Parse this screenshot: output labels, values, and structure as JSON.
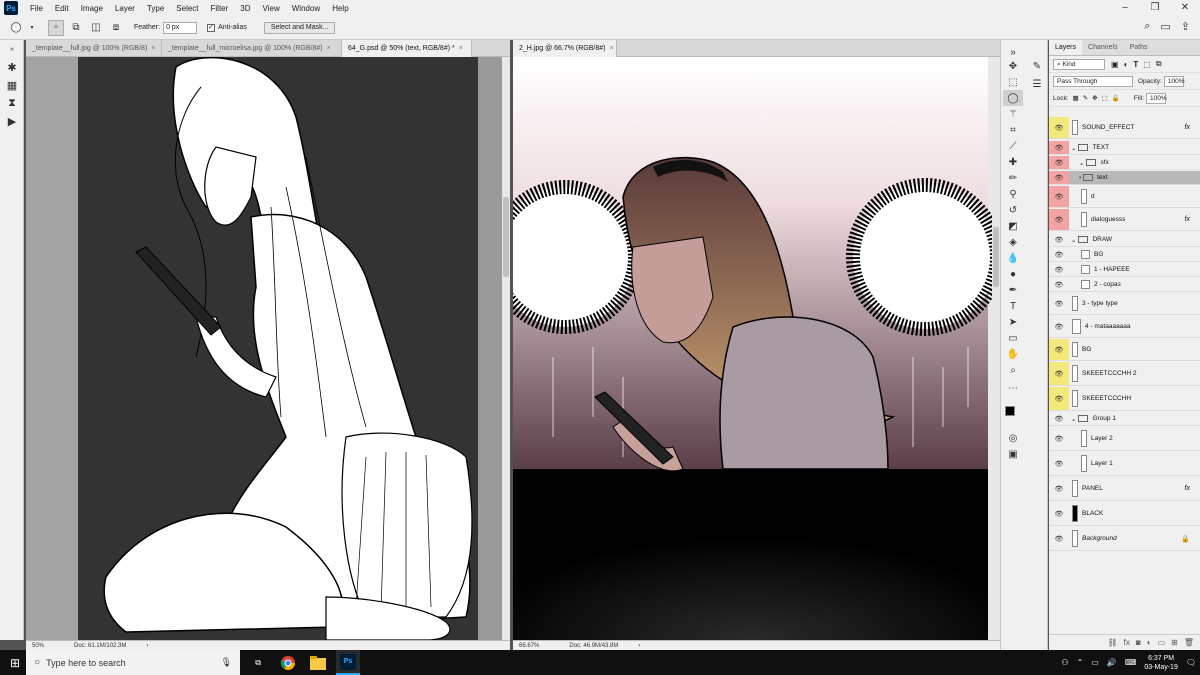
{
  "menubar": {
    "logo": "Ps",
    "items": [
      "File",
      "Edit",
      "Image",
      "Layer",
      "Type",
      "Select",
      "Filter",
      "3D",
      "View",
      "Window",
      "Help"
    ]
  },
  "options": {
    "feather_label": "Feather:",
    "feather_value": "0 px",
    "antialias_label": "Anti-alias",
    "select_mask_label": "Select and Mask..."
  },
  "documents": {
    "tabs_left": [
      "_template__full.jpg @ 100% (RGB/8)",
      "_template__full_microelisa.jpg @ 100% (RGB/8#)",
      "64_G.psd @ 50% (text, RGB/8#) *"
    ],
    "tabs_right": [
      "2_H.jpg @ 66.7% (RGB/8#)"
    ],
    "left_zoom": "50%",
    "left_doc": "Doc: 61.1M/102.3M",
    "right_zoom": "66.67%",
    "right_doc": "Doc: 46.9M/43.8M"
  },
  "panel": {
    "tabs": [
      "Layers",
      "Channels",
      "Paths"
    ],
    "kind": "Kind",
    "blend_mode": "Pass Through",
    "opacity_label": "Opacity:",
    "opacity_value": "100%",
    "lock_label": "Lock:",
    "fill_label": "Fill:",
    "fill_value": "100%",
    "layers": [
      {
        "name": "SOUND_EFFECT",
        "color": "#f3e97a",
        "fx": "fx"
      },
      {
        "name": "TEXT",
        "color": "#f4a3a3",
        "fx": ""
      },
      {
        "name": "sfx",
        "color": "#f4a3a3",
        "fx": ""
      },
      {
        "name": "text",
        "color": "#f4a3a3",
        "fx": ""
      },
      {
        "name": "d",
        "color": "#f4a3a3",
        "fx": ""
      },
      {
        "name": "dialoguesss",
        "color": "#f4a3a3",
        "fx": "fx"
      },
      {
        "name": "DRAW",
        "color": "",
        "fx": ""
      },
      {
        "name": "BG",
        "color": "",
        "fx": ""
      },
      {
        "name": "1 - HAPEEE",
        "color": "",
        "fx": ""
      },
      {
        "name": "2 - copas",
        "color": "",
        "fx": ""
      },
      {
        "name": "3 - type type",
        "color": "",
        "fx": ""
      },
      {
        "name": "4 - mataaaaaaa",
        "color": "",
        "fx": ""
      },
      {
        "name": "BG",
        "color": "#f3e97a",
        "fx": ""
      },
      {
        "name": "SKEEETCCCHH 2",
        "color": "#f3e97a",
        "fx": ""
      },
      {
        "name": "SKEEETCCCHH",
        "color": "#f3e97a",
        "fx": ""
      },
      {
        "name": "Group 1",
        "color": "",
        "fx": ""
      },
      {
        "name": "Layer 2",
        "color": "",
        "fx": ""
      },
      {
        "name": "Layer 1",
        "color": "",
        "fx": ""
      },
      {
        "name": "PANEL",
        "color": "",
        "fx": "fx"
      },
      {
        "name": "BLACK",
        "color": "",
        "fx": ""
      },
      {
        "name": "Background",
        "color": "",
        "fx": ""
      }
    ]
  },
  "taskbar": {
    "search_placeholder": "Type here to search",
    "time": "6:37 PM",
    "date": "03-May-19"
  }
}
